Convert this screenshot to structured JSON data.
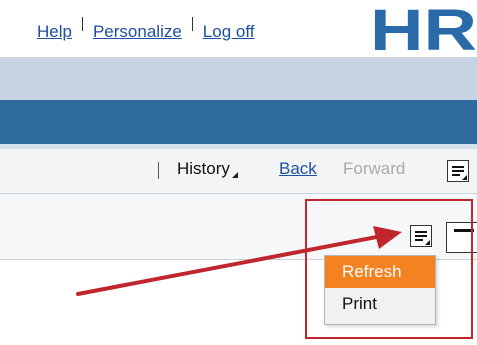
{
  "header": {
    "links": {
      "help": "Help",
      "personalize": "Personalize",
      "logoff": "Log off"
    },
    "logo_text": "HR"
  },
  "nav": {
    "history": "History",
    "back": "Back",
    "forward": "Forward"
  },
  "menu": {
    "items": [
      "Refresh",
      "Print"
    ],
    "active_index": 0
  },
  "colors": {
    "link": "#1f4fa0",
    "band_light": "#c7d3e2",
    "band_dark": "#2e6a9b",
    "highlight_border": "#c0272d",
    "menu_active": "#f58220",
    "arrow": "#c0272d"
  },
  "icons": [
    "text-lines-menu-icon",
    "dash-icon",
    "dropdown-triangle-icon"
  ]
}
